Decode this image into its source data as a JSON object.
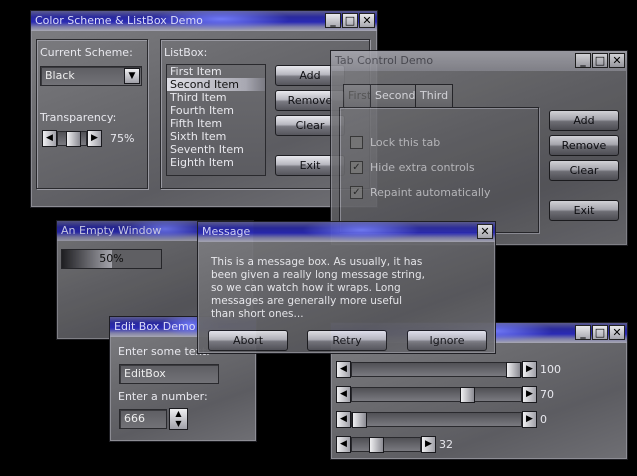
{
  "scheme_win": {
    "title": "Color Scheme & ListBox Demo",
    "current_scheme_label": "Current Scheme:",
    "scheme_value": "Black",
    "transparency_label": "Transparency:",
    "transparency_value": "75%",
    "transparency_level": 0.75,
    "listbox_label": "ListBox:",
    "items": [
      "First Item",
      "Second Item",
      "Third Item",
      "Fourth Item",
      "Fifth Item",
      "Sixth Item",
      "Seventh Item",
      "Eighth Item"
    ],
    "selected_index": 1,
    "add": "Add",
    "remove": "Remove",
    "clear": "Clear",
    "exit": "Exit"
  },
  "tab_win": {
    "title": "Tab Control Demo",
    "tabs": [
      "First",
      "Second",
      "Third"
    ],
    "lock": "Lock this tab",
    "hide": "Hide extra controls",
    "repaint": "Repaint automatically",
    "lock_checked": false,
    "hide_checked": true,
    "repaint_checked": true,
    "add": "Add",
    "remove": "Remove",
    "clear": "Clear",
    "exit": "Exit"
  },
  "empty_win": {
    "title": "An Empty Window",
    "progress_text": "50%",
    "progress": 0.5
  },
  "message_win": {
    "title": "Message",
    "text": "This is a message box. As usually, it has been given a really long message string, so we can watch how it wraps. Long messages are generally more useful than short ones...",
    "abort": "Abort",
    "retry": "Retry",
    "ignore": "Ignore"
  },
  "editbox_win": {
    "title": "Edit Box Demo",
    "prompt": "Enter some text:",
    "text_value": "EditBox",
    "number_label": "Enter a number:",
    "number_value": "666"
  },
  "slider_win": {
    "sliders": [
      {
        "value": "100",
        "level": 1.0
      },
      {
        "value": "70",
        "level": 0.7
      },
      {
        "value": "0",
        "level": 0
      },
      {
        "value": "32",
        "level": 0.32
      }
    ]
  },
  "icons": {
    "minimize": "minimize-icon",
    "maximize": "maximize-icon",
    "close": "close-icon"
  }
}
